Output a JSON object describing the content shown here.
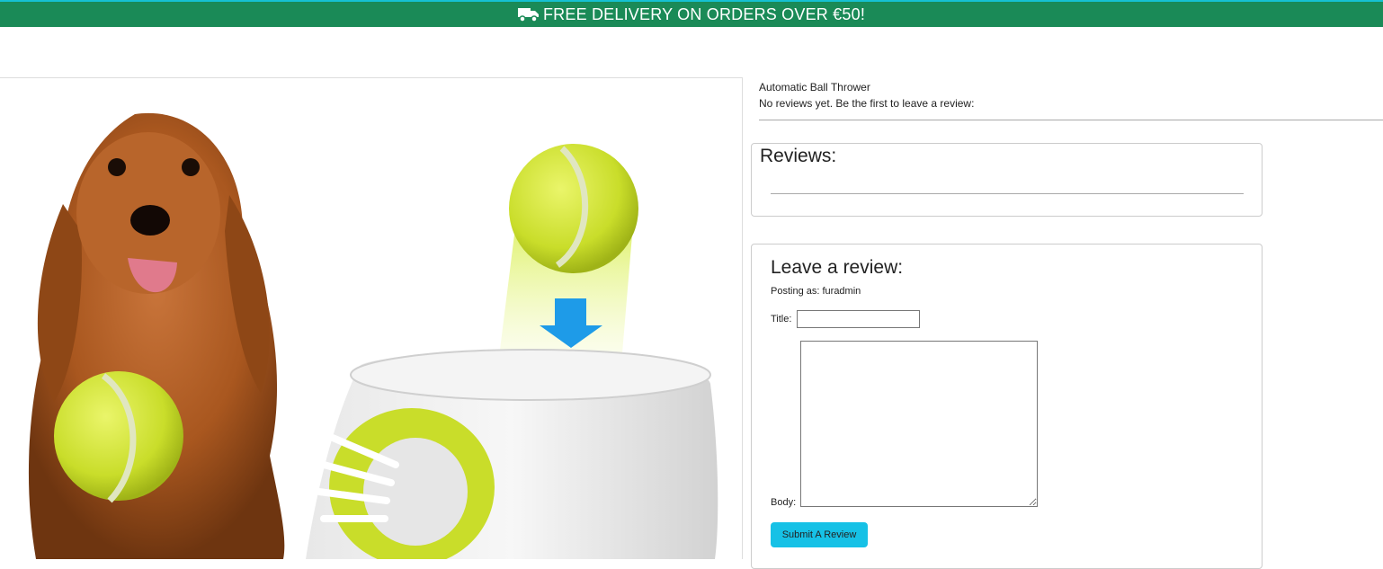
{
  "banner": {
    "text": "FREE DELIVERY ON ORDERS OVER €50!",
    "icon": "truck-icon",
    "color": "#1a8a57",
    "accent_line": "#16c1d3"
  },
  "product": {
    "image_alt": "Automatic Ball Thrower",
    "name": "Automatic Ball Thrower",
    "reviews_note": "No reviews yet. Be the first to leave a review:"
  },
  "reviews": {
    "heading": "Reviews:"
  },
  "review_form": {
    "heading": "Leave a review:",
    "posting_as": "Posting as: furadmin",
    "title_label": "Title:",
    "title_value": "",
    "body_label": "Body:",
    "body_value": "",
    "submit_label": "Submit A Review",
    "submit_color": "#16c1e6"
  }
}
